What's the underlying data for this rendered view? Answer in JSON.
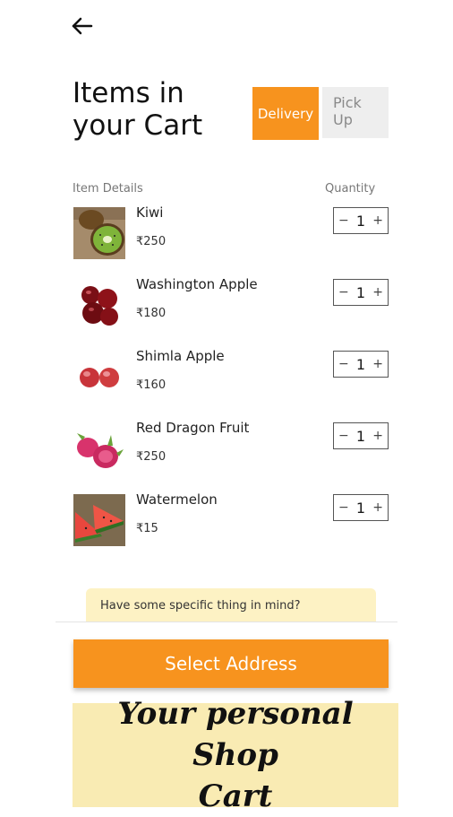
{
  "header": {
    "back_icon": "arrow-left-icon",
    "title_line1": "Items in",
    "title_line2": "your Cart"
  },
  "mode_toggle": {
    "delivery_label": "Delivery",
    "pickup_label_line1": "Pick",
    "pickup_label_line2": "Up",
    "selected": "Delivery"
  },
  "columns": {
    "item_details": "Item Details",
    "quantity": "Quantity"
  },
  "items": [
    {
      "name": "Kiwi",
      "price": "₹250",
      "quantity": "1"
    },
    {
      "name": "Washington Apple",
      "price": "₹180",
      "quantity": "1"
    },
    {
      "name": "Shimla Apple",
      "price": "₹160",
      "quantity": "1"
    },
    {
      "name": "Red Dragon Fruit",
      "price": "₹250",
      "quantity": "1"
    },
    {
      "name": "Watermelon",
      "price": "₹15",
      "quantity": "1"
    }
  ],
  "stepper": {
    "minus": "−",
    "plus": "+"
  },
  "hint": "Have some specific thing in mind?",
  "cta_label": "Select Address",
  "banner": {
    "line1": "Your personal Shop",
    "line2": "Cart"
  },
  "colors": {
    "accent": "#f7931e",
    "hint_bg": "#fdf2c4",
    "banner_bg": "#f9ebb3"
  }
}
